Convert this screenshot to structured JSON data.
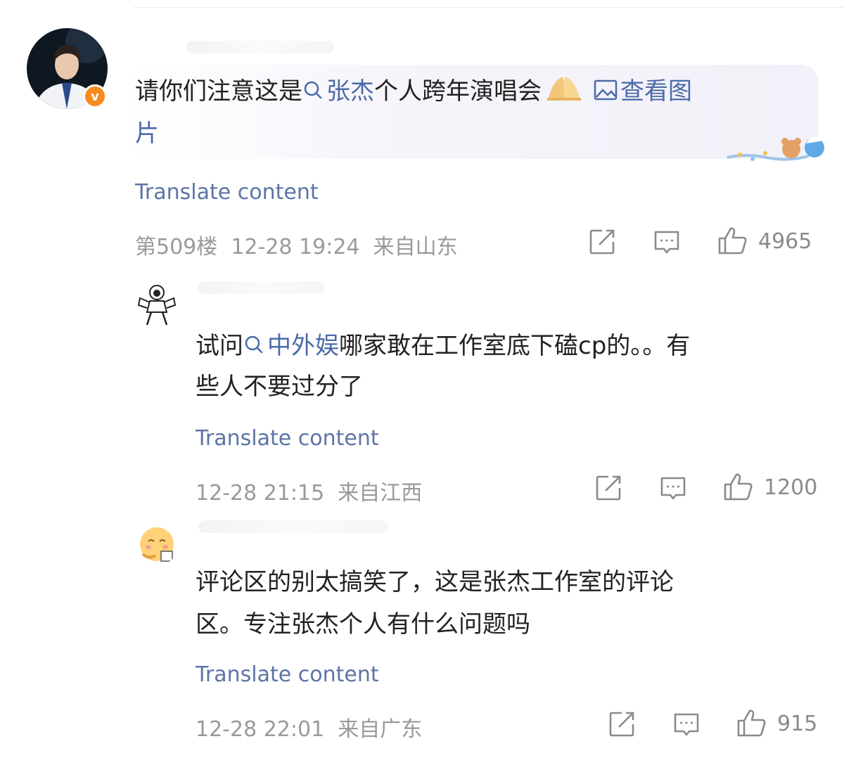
{
  "comments": [
    {
      "text_pre": "请你们注意这是",
      "link": "张杰",
      "text_post": "个人跨年演唱会",
      "view_image": "查看图",
      "view_image_tail": "片",
      "translate": "Translate content",
      "meta": "第509楼  12-28 19:24  来自山东",
      "likes": "4965",
      "verified_badge": "v"
    },
    {
      "text_pre": "试问",
      "link": "中外娱",
      "text_post": "哪家敢在工作室底下磕cp的。。有",
      "text_line2": "些人不要过分了",
      "translate": "Translate content",
      "meta": "12-28 21:15  来自江西",
      "likes": "1200"
    },
    {
      "text_line1": "评论区的别太搞笑了，这是张杰工作室的评论",
      "text_line2": "区。专注张杰个人有什么问题吗",
      "translate": "Translate content",
      "meta": "12-28 22:01  来自广东",
      "likes": "915"
    }
  ],
  "icons": [
    "share-icon",
    "comment-icon",
    "like-icon",
    "search-icon",
    "image-icon"
  ],
  "colors": {
    "link": "#4b6aa8",
    "meta": "#9a9a9a",
    "badge": "#f68a1f"
  }
}
